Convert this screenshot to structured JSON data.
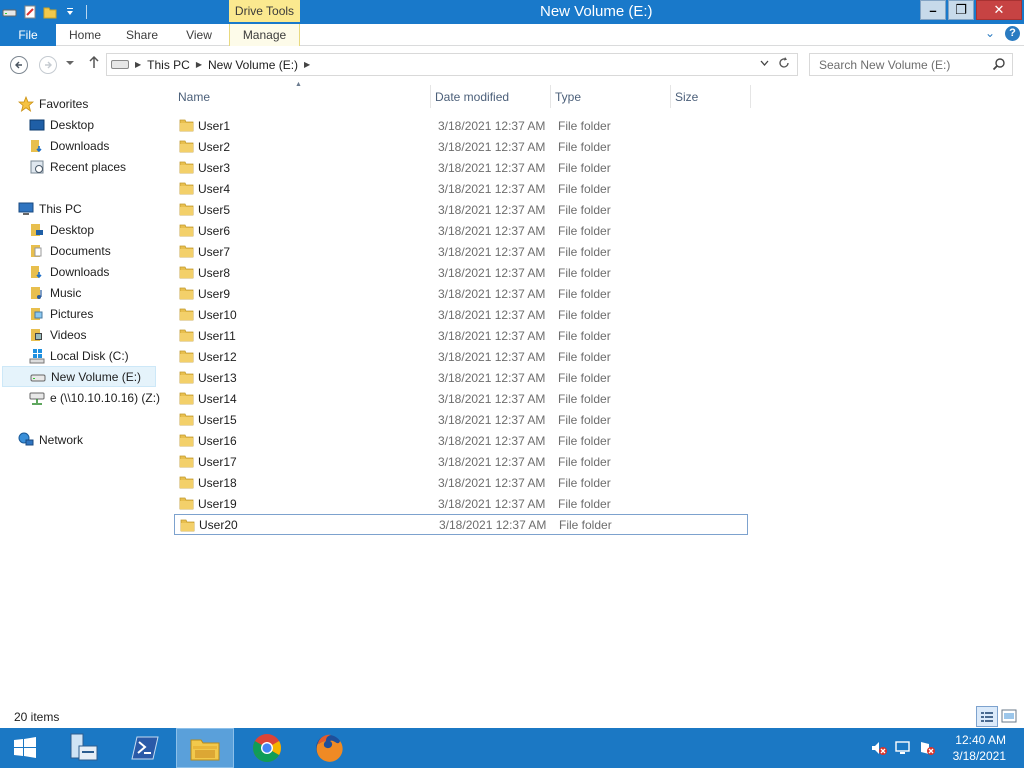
{
  "window": {
    "title": "New Volume (E:)",
    "contextual_tab_group": "Drive Tools",
    "minimize": "–",
    "restore": "❐",
    "close": "✕"
  },
  "ribbon": {
    "tabs": [
      {
        "label": "File"
      },
      {
        "label": "Home"
      },
      {
        "label": "Share"
      },
      {
        "label": "View"
      },
      {
        "label": "Manage"
      }
    ],
    "expand_glyph": "⌄",
    "help_glyph": "?"
  },
  "address": {
    "crumbs": [
      "This PC",
      "New Volume (E:)"
    ],
    "search_placeholder": "Search New Volume (E:)"
  },
  "navpane": {
    "favorites": {
      "label": "Favorites",
      "items": [
        "Desktop",
        "Downloads",
        "Recent places"
      ]
    },
    "this_pc": {
      "label": "This PC",
      "items": [
        "Desktop",
        "Documents",
        "Downloads",
        "Music",
        "Pictures",
        "Videos",
        "Local Disk (C:)",
        "New Volume (E:)",
        "e (\\\\10.10.10.16) (Z:)"
      ]
    },
    "network": {
      "label": "Network"
    }
  },
  "columns": {
    "name": "Name",
    "date": "Date modified",
    "type": "Type",
    "size": "Size"
  },
  "files": [
    {
      "name": "User1",
      "date": "3/18/2021 12:37 AM",
      "type": "File folder"
    },
    {
      "name": "User2",
      "date": "3/18/2021 12:37 AM",
      "type": "File folder"
    },
    {
      "name": "User3",
      "date": "3/18/2021 12:37 AM",
      "type": "File folder"
    },
    {
      "name": "User4",
      "date": "3/18/2021 12:37 AM",
      "type": "File folder"
    },
    {
      "name": "User5",
      "date": "3/18/2021 12:37 AM",
      "type": "File folder"
    },
    {
      "name": "User6",
      "date": "3/18/2021 12:37 AM",
      "type": "File folder"
    },
    {
      "name": "User7",
      "date": "3/18/2021 12:37 AM",
      "type": "File folder"
    },
    {
      "name": "User8",
      "date": "3/18/2021 12:37 AM",
      "type": "File folder"
    },
    {
      "name": "User9",
      "date": "3/18/2021 12:37 AM",
      "type": "File folder"
    },
    {
      "name": "User10",
      "date": "3/18/2021 12:37 AM",
      "type": "File folder"
    },
    {
      "name": "User11",
      "date": "3/18/2021 12:37 AM",
      "type": "File folder"
    },
    {
      "name": "User12",
      "date": "3/18/2021 12:37 AM",
      "type": "File folder"
    },
    {
      "name": "User13",
      "date": "3/18/2021 12:37 AM",
      "type": "File folder"
    },
    {
      "name": "User14",
      "date": "3/18/2021 12:37 AM",
      "type": "File folder"
    },
    {
      "name": "User15",
      "date": "3/18/2021 12:37 AM",
      "type": "File folder"
    },
    {
      "name": "User16",
      "date": "3/18/2021 12:37 AM",
      "type": "File folder"
    },
    {
      "name": "User17",
      "date": "3/18/2021 12:37 AM",
      "type": "File folder"
    },
    {
      "name": "User18",
      "date": "3/18/2021 12:37 AM",
      "type": "File folder"
    },
    {
      "name": "User19",
      "date": "3/18/2021 12:37 AM",
      "type": "File folder"
    },
    {
      "name": "User20",
      "date": "3/18/2021 12:37 AM",
      "type": "File folder"
    }
  ],
  "status": {
    "item_count": "20 items"
  },
  "taskbar": {
    "time": "12:40 AM",
    "date": "3/18/2021"
  },
  "colors": {
    "titlebar": "#1979ca",
    "taskbar": "#1b78c4",
    "drive_tools": "#fbe98f",
    "folder": "#e8bf4e"
  }
}
